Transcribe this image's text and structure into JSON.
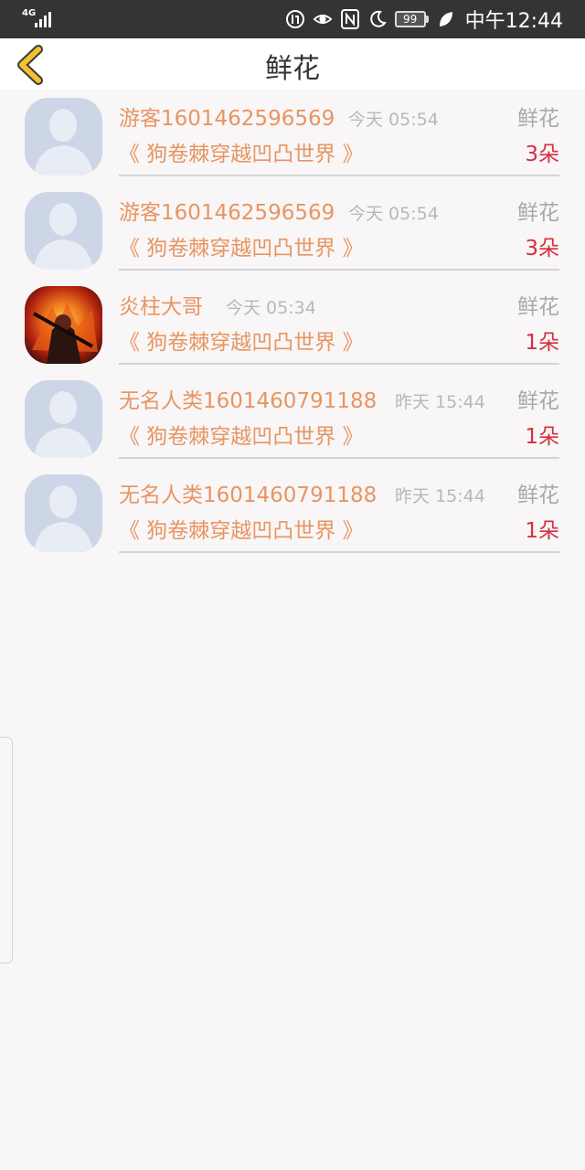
{
  "status_bar": {
    "network": "4G",
    "battery": "99",
    "time": "中午12:44"
  },
  "nav": {
    "title": "鲜花",
    "back_icon": "chevron-left-icon"
  },
  "colors": {
    "accent_orange": "#e89561",
    "count_red": "#d6303e",
    "back_yellow": "#f2c230"
  },
  "items": [
    {
      "name": "游客1601462596569",
      "time": "今天 05:54",
      "type": "鲜花",
      "book": "《 狗卷棘穿越凹凸世界 》",
      "count": "3朵",
      "avatar": "default-avatar"
    },
    {
      "name": "游客1601462596569",
      "time": "今天 05:54",
      "type": "鲜花",
      "book": "《 狗卷棘穿越凹凸世界 》",
      "count": "3朵",
      "avatar": "default-avatar"
    },
    {
      "name": "炎柱大哥",
      "time": "今天 05:34",
      "type": "鲜花",
      "book": "《 狗卷棘穿越凹凸世界 》",
      "count": "1朵",
      "avatar": "custom-avatar"
    },
    {
      "name": "无名人类1601460791188",
      "time": "昨天 15:44",
      "type": "鲜花",
      "book": "《 狗卷棘穿越凹凸世界 》",
      "count": "1朵",
      "avatar": "default-avatar"
    },
    {
      "name": "无名人类1601460791188",
      "time": "昨天 15:44",
      "type": "鲜花",
      "book": "《 狗卷棘穿越凹凸世界 》",
      "count": "1朵",
      "avatar": "default-avatar"
    }
  ]
}
